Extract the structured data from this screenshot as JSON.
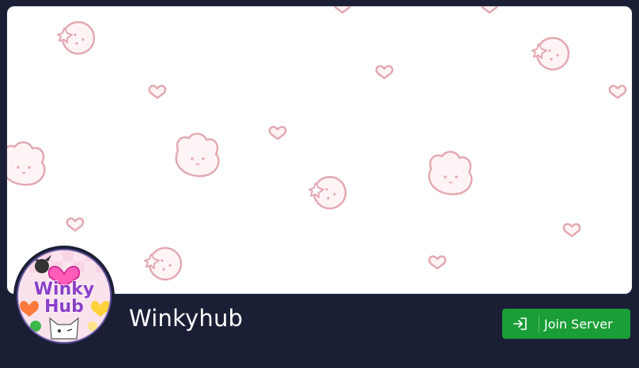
{
  "server": {
    "name": "Winkyhub",
    "logo_text_line1": "Winky",
    "logo_text_line2": "Hub"
  },
  "actions": {
    "join_label": "Join Server"
  },
  "icons": {
    "join": "enter-icon"
  },
  "colors": {
    "background": "#1b1f35",
    "join_button": "#1a9e37",
    "banner_pattern": "#e8b4bd",
    "logo_text": "#8a3fc8"
  }
}
